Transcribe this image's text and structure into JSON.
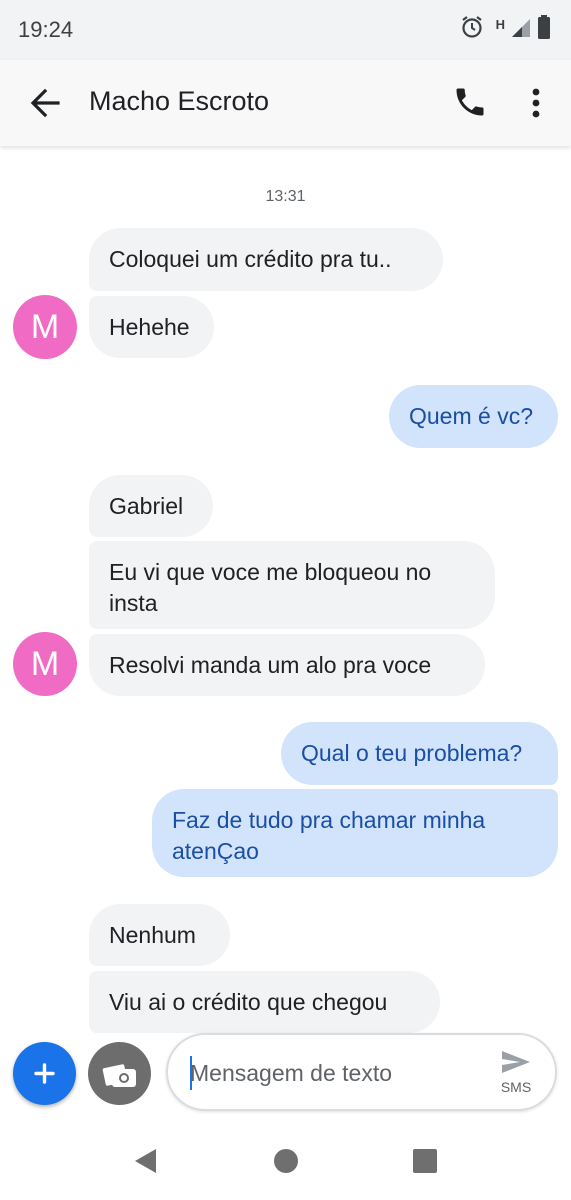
{
  "status_bar": {
    "time": "19:24",
    "network_label": "H",
    "icons": [
      "alarm-icon",
      "signal-icon",
      "battery-icon"
    ]
  },
  "app_bar": {
    "contact_name": "Macho Escroto",
    "icons": [
      "back-arrow-icon",
      "phone-icon",
      "more-vert-icon"
    ]
  },
  "conversation": {
    "timestamp": "13:31",
    "messages": [
      {
        "direction": "incoming",
        "text": "Coloquei um crédito pra tu.."
      },
      {
        "direction": "incoming",
        "text": "Hehehe"
      },
      {
        "direction": "outgoing",
        "text": "Quem é vc?"
      },
      {
        "direction": "incoming",
        "text": "Gabriel"
      },
      {
        "direction": "incoming",
        "text": "Eu vi que voce me bloqueou no insta"
      },
      {
        "direction": "incoming",
        "text": "Resolvi manda um alo pra voce"
      },
      {
        "direction": "outgoing",
        "text": "Qual o teu problema?"
      },
      {
        "direction": "outgoing",
        "text": "Faz de tudo pra chamar minha atenÇao"
      },
      {
        "direction": "incoming",
        "text": "Nenhum"
      },
      {
        "direction": "incoming",
        "text": "Viu ai o crédito que chegou"
      }
    ],
    "avatar_letter": "M"
  },
  "compose": {
    "placeholder": "Mensagem de texto",
    "value": "",
    "send_label": "SMS"
  },
  "colors": {
    "incoming_bubble": "#f1f3f4",
    "outgoing_bubble": "#d2e3fc",
    "outgoing_text": "#1a4fa5",
    "avatar": "#f06bc4",
    "accent": "#1a73e8"
  },
  "nav_bar": {
    "icons": [
      "back-triangle-icon",
      "home-circle-icon",
      "recents-square-icon"
    ]
  }
}
